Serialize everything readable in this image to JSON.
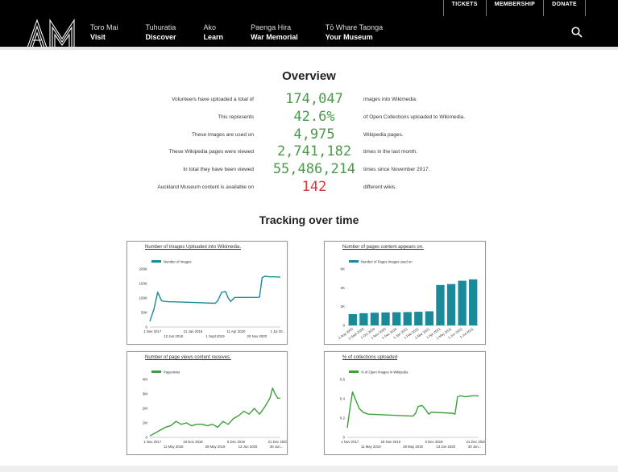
{
  "header": {
    "top_links": [
      "TICKETS",
      "MEMBERSHIP",
      "DONATE"
    ],
    "logo_text": "AM",
    "nav": [
      {
        "maori": "Toro Mai",
        "english": "Visit"
      },
      {
        "maori": "Tuhuratia",
        "english": "Discover"
      },
      {
        "maori": "Ako",
        "english": "Learn"
      },
      {
        "maori": "Paenga Hira",
        "english": "War Memorial"
      },
      {
        "maori": "Tō Whare Taonga",
        "english": "Your Museum"
      }
    ],
    "search_icon": "search-icon"
  },
  "overview": {
    "title": "Overview",
    "rows": [
      {
        "label": "Volunteers have uploaded a total of",
        "value": "174,047",
        "suffix": "images into Wikimedia.",
        "color": "#4a9a4a"
      },
      {
        "label": "This represents",
        "value": "42.6%",
        "suffix": "of Open Collections uploaded to Wikimedia.",
        "color": "#4a9a4a"
      },
      {
        "label": "These images are used on",
        "value": "4,975",
        "suffix": "Wikipedia pages.",
        "color": "#4a9a4a"
      },
      {
        "label": "These Wikipedia pages were viewed",
        "value": "2,741,182",
        "suffix": "times in the last month.",
        "color": "#4a9a4a"
      },
      {
        "label": "In total they have been viewed",
        "value": "55,486,214",
        "suffix": "times since November 2017.",
        "color": "#4a9a4a"
      },
      {
        "label": "Auckland Museum content is available on",
        "value": "142",
        "suffix": "different wikis.",
        "color": "#d23a3a"
      }
    ]
  },
  "tracking": {
    "title": "Tracking over time"
  },
  "chart_data": [
    {
      "type": "line",
      "title": "Number of Images Uploaded into Wikimedia.",
      "legend": "Number of Images",
      "color": "#1a8a9a",
      "yticks": [
        "0",
        "50K",
        "100K",
        "150K",
        "200K"
      ],
      "ylim": [
        0,
        200000
      ],
      "xticks_top": [
        "1 Nov 2017",
        "21 Jan 2019",
        "11 Apr 2020",
        "1 Jul 20..."
      ],
      "xticks_bottom": [
        "12 Jun 2018",
        "1 Sept 2019",
        "20 Nov 2020"
      ],
      "x": [
        0,
        0.03,
        0.06,
        0.09,
        0.12,
        0.15,
        0.18,
        0.5,
        0.52,
        0.55,
        0.58,
        0.6,
        0.62,
        0.65,
        0.82,
        0.84,
        0.86,
        0.88,
        0.92,
        0.96,
        1.0
      ],
      "values": [
        20000,
        60000,
        120000,
        90000,
        88000,
        87000,
        87000,
        82000,
        90000,
        120000,
        122000,
        100000,
        88000,
        102000,
        102000,
        103000,
        170000,
        175000,
        173000,
        173000,
        172000
      ]
    },
    {
      "type": "bar",
      "title": "Number of pages content appears on.",
      "legend": "Number of Pages Images used on",
      "color": "#1a8a9a",
      "yticks": [
        "0",
        "2K",
        "4K",
        "6K"
      ],
      "ylim": [
        0,
        6000
      ],
      "categories": [
        "1 Aug 2020",
        "1 Sept 2020",
        "1 Oct 2020",
        "1 Nov 2020",
        "1 Dec 2020",
        "1 Jan 2021",
        "1 Feb 2021",
        "1 Mar 2021",
        "1 Apr 2021",
        "1 May 2021",
        "1 Jun 2021",
        "1 Jul 2021"
      ],
      "values": [
        1200,
        1300,
        1350,
        1380,
        1400,
        1420,
        1450,
        1500,
        4300,
        4400,
        4750,
        4900
      ]
    },
    {
      "type": "line",
      "title": "Number of page views content receives.",
      "legend": "Pageviews",
      "color": "#3aa03a",
      "yticks": [
        "0",
        "1M",
        "2M",
        "3M",
        "4M"
      ],
      "ylim": [
        0,
        4000000
      ],
      "xticks_top": [
        "1 Nov 2017",
        "18 Nov 2018",
        "5 Dec 2019",
        "21 Dec 2020"
      ],
      "xticks_bottom": [
        "11 May 2018",
        "28 May 2019",
        "13 Jun 2020",
        "30 Jun..."
      ],
      "x": [
        0,
        0.04,
        0.08,
        0.12,
        0.16,
        0.2,
        0.24,
        0.28,
        0.32,
        0.36,
        0.4,
        0.44,
        0.48,
        0.52,
        0.56,
        0.6,
        0.64,
        0.68,
        0.72,
        0.76,
        0.8,
        0.84,
        0.88,
        0.92,
        0.94,
        0.96,
        0.98,
        1.0
      ],
      "values": [
        100000,
        300000,
        500000,
        700000,
        800000,
        1100000,
        900000,
        1000000,
        800000,
        900000,
        900000,
        800000,
        900000,
        700000,
        1100000,
        900000,
        1300000,
        1500000,
        1800000,
        1600000,
        2000000,
        1600000,
        2100000,
        2700000,
        3400000,
        3000000,
        2700000,
        2700000
      ]
    },
    {
      "type": "line",
      "title": "% of collections uploaded",
      "legend": "% of Open Images in Wikipedia",
      "color": "#3aa03a",
      "yticks": [
        "0",
        "0.2",
        "0.4",
        "0.6"
      ],
      "ylim": [
        0,
        0.6
      ],
      "xticks_top": [
        "1 Nov 2017",
        "18 Nov 2018",
        "5 Dec 2019",
        "21 Dec 2020"
      ],
      "xticks_bottom": [
        "11 May 2018",
        "28 May 2019",
        "13 Jun 2020",
        "30 Jun..."
      ],
      "x": [
        0,
        0.02,
        0.04,
        0.06,
        0.09,
        0.12,
        0.16,
        0.5,
        0.52,
        0.54,
        0.57,
        0.6,
        0.62,
        0.64,
        0.8,
        0.82,
        0.84,
        0.86,
        0.9,
        0.95,
        1.0
      ],
      "values": [
        0.1,
        0.3,
        0.47,
        0.4,
        0.3,
        0.26,
        0.24,
        0.22,
        0.25,
        0.32,
        0.33,
        0.28,
        0.24,
        0.26,
        0.25,
        0.24,
        0.42,
        0.43,
        0.42,
        0.43,
        0.43
      ]
    }
  ]
}
